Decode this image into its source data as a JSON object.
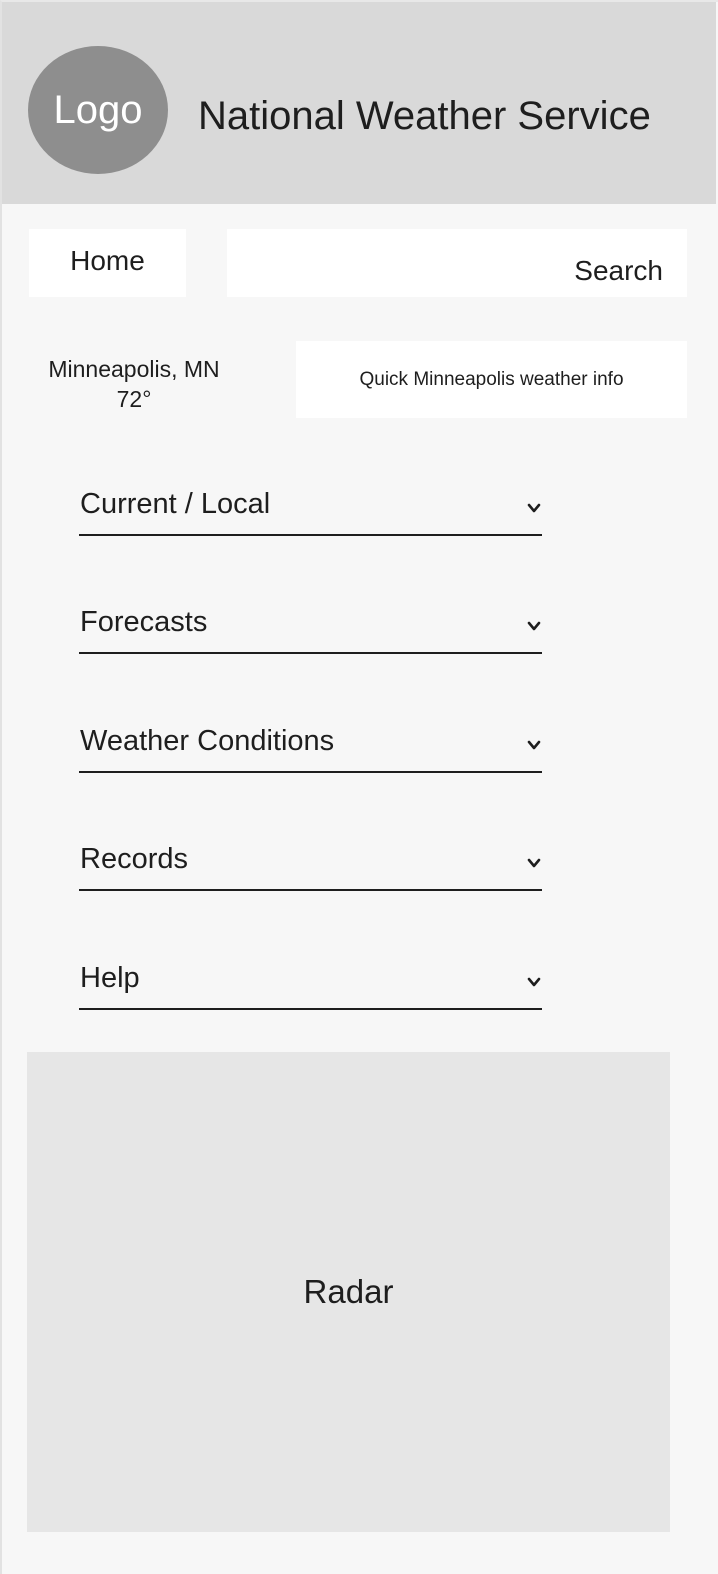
{
  "header": {
    "logo_text": "Logo",
    "title": "National Weather Service",
    "background_color": "#d9d9d9",
    "logo_color": "#8e8e8e"
  },
  "nav": {
    "home_label": "Home",
    "search_label": "Search"
  },
  "location": {
    "city": "Minneapolis, MN",
    "temperature": "72°",
    "quick_info": "Quick Minneapolis weather info"
  },
  "menu": {
    "items": [
      {
        "label": "Current / Local",
        "icon": "chevron-down-icon"
      },
      {
        "label": "Forecasts",
        "icon": "chevron-down-icon"
      },
      {
        "label": "Weather Conditions",
        "icon": "chevron-down-icon"
      },
      {
        "label": "Records",
        "icon": "chevron-down-icon"
      },
      {
        "label": "Help",
        "icon": "chevron-down-icon"
      }
    ]
  },
  "radar": {
    "label": "Radar",
    "background_color": "#e6e6e6"
  }
}
